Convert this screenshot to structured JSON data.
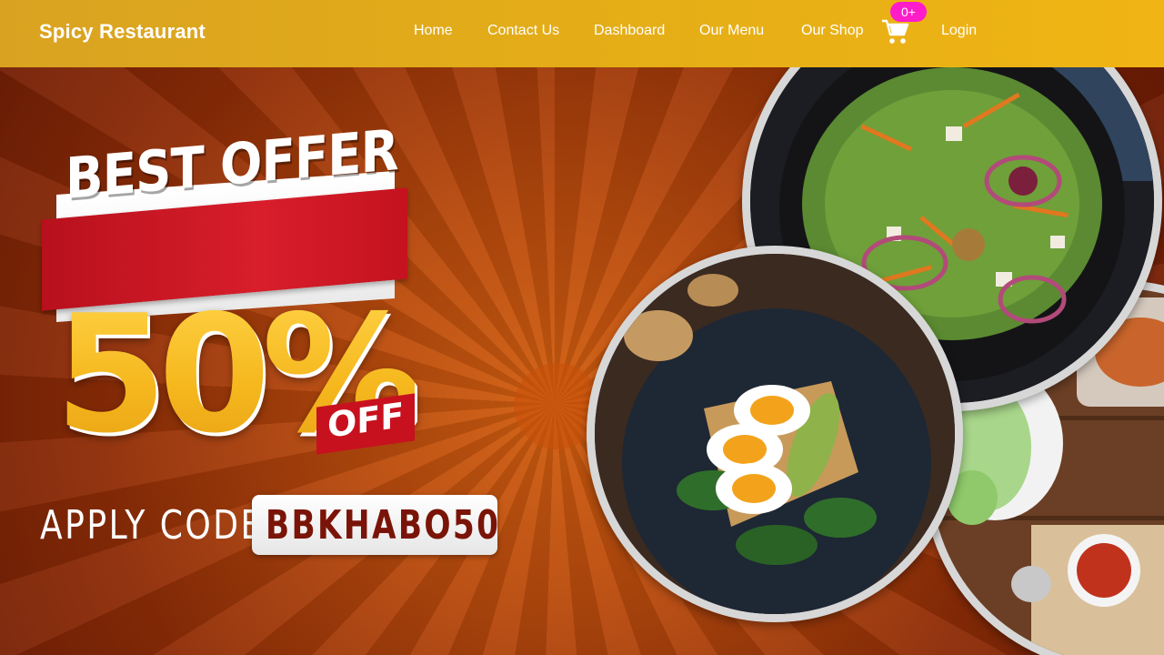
{
  "navbar": {
    "brand": "Spicy Restaurant",
    "links": [
      "Home",
      "Contact Us",
      "Dashboard",
      "Our Menu",
      "Our Shop"
    ],
    "cart_badge": "0+",
    "login": "Login",
    "cart_icon": "cart-icon"
  },
  "hero": {
    "offer_title": "BEST OFFER",
    "offer_percent": "50%",
    "offer_off": "OFF",
    "apply_label": "APPLY CODE",
    "promo_code": "BBKHABO50",
    "images": [
      "salad-dish-image",
      "egg-toast-dish-image",
      "table-spread-image"
    ]
  },
  "colors": {
    "nav_bg": "#e4ad17",
    "badge": "#ff1cc9",
    "hero_bg": "#b84a0d",
    "offer_red": "#d81e2b",
    "percent_yellow": "#f7c12b"
  }
}
